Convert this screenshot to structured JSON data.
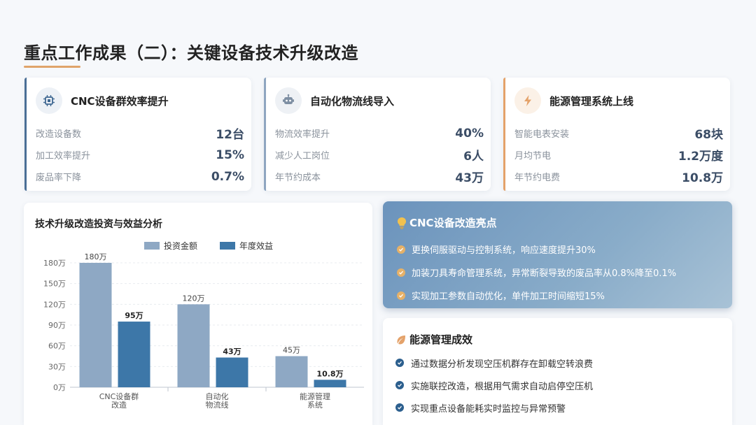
{
  "page": {
    "title": "重点工作成果（二）：关键设备技术升级改造"
  },
  "kpi_cards": [
    {
      "title": "CNC设备群效率提升",
      "icon": "chip-icon",
      "accent": "#4a6f96",
      "rows": [
        {
          "label": "改造设备数",
          "value": "12台"
        },
        {
          "label": "加工效率提升",
          "value": "15%"
        },
        {
          "label": "废品率下降",
          "value": "0.7%"
        }
      ]
    },
    {
      "title": "自动化物流线导入",
      "icon": "robot-icon",
      "accent": "#8ea5c0",
      "rows": [
        {
          "label": "物流效率提升",
          "value": "40%"
        },
        {
          "label": "减少人工岗位",
          "value": "6人"
        },
        {
          "label": "年节约成本",
          "value": "43万"
        }
      ]
    },
    {
      "title": "能源管理系统上线",
      "icon": "lightning-icon",
      "accent": "#e4a26a",
      "rows": [
        {
          "label": "智能电表安装",
          "value": "68块"
        },
        {
          "label": "月均节电",
          "value": "1.2万度"
        },
        {
          "label": "年节约电费",
          "value": "10.8万"
        }
      ]
    }
  ],
  "chart_card": {
    "title": "技术升级改造投资与效益分析"
  },
  "chart_data": {
    "type": "bar",
    "categories": [
      [
        "CNC设备群",
        "改造"
      ],
      [
        "自动化",
        "物流线"
      ],
      [
        "能源管理",
        "系统"
      ]
    ],
    "series": [
      {
        "name": "投资金额",
        "values": [
          180,
          120,
          45
        ],
        "labels": [
          "180万",
          "120万",
          "45万"
        ],
        "color": "#8ea8c4"
      },
      {
        "name": "年度效益",
        "values": [
          95,
          43,
          10.8
        ],
        "labels": [
          "95万",
          "43万",
          "10.8万"
        ],
        "color": "#3d77a8"
      }
    ],
    "yticks": [
      0,
      30,
      60,
      90,
      120,
      150,
      180
    ],
    "ytick_labels": [
      "0万",
      "30万",
      "60万",
      "90万",
      "120万",
      "150万",
      "180万"
    ],
    "ylim": [
      0,
      180
    ],
    "grid": true,
    "legend": "top-center"
  },
  "highlight_card": {
    "title": "CNC设备改造亮点",
    "items": [
      "更换伺服驱动与控制系统，响应速度提升30%",
      "加装刀具寿命管理系统，异常断裂导致的废品率从0.8%降至0.1%",
      "实现加工参数自动优化，单件加工时间缩短15%"
    ]
  },
  "energy_card": {
    "title": "能源管理成效",
    "items": [
      "通过数据分析发现空压机群存在卸载空转浪费",
      "实施联控改造，根据用气需求自动启停空压机",
      "实现重点设备能耗实时监控与异常预警"
    ]
  }
}
